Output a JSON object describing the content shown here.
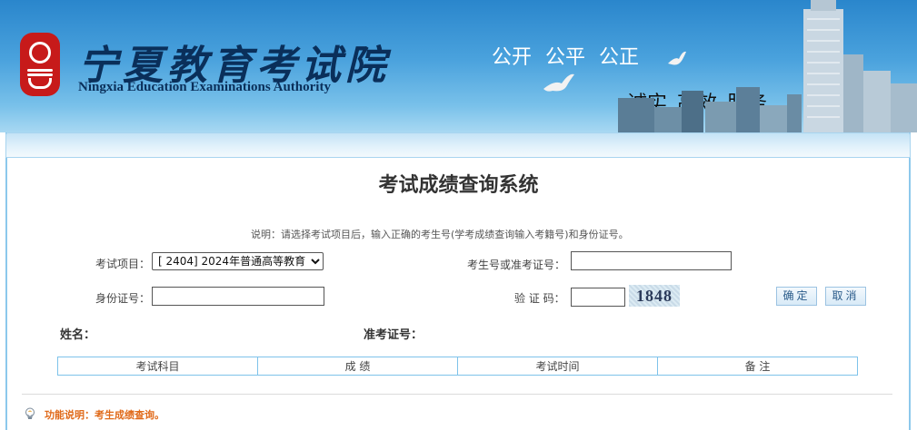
{
  "header": {
    "logo_cn": "宁夏教育考试院",
    "logo_en": "Ningxia Education Examinations Authority",
    "slogan_top": "公开  公平  公正",
    "slogan_bottom": "诚实  高效  服务"
  },
  "page": {
    "title": "考试成绩查询系统",
    "description": "说明：请选择考试项目后，输入正确的考生号(学考成绩查询输入考籍号)和身份证号。"
  },
  "form": {
    "exam_label": "考试项目：",
    "exam_selected": "[ 2404] 2024年普通高等教育",
    "candidate_no_label": "考生号或准考证号：",
    "candidate_no_value": "",
    "id_label": "身份证号：",
    "id_value": "",
    "captcha_label": "验 证 码：",
    "captcha_value": "",
    "captcha_image_text": "1848",
    "confirm_button": "确定",
    "cancel_button": "取消"
  },
  "info": {
    "name_label": "姓名：",
    "admission_label": "准考证号："
  },
  "results_table": {
    "columns": [
      "考试科目",
      "成 绩",
      "考试时间",
      "备 注"
    ]
  },
  "footer": {
    "tip_icon": "lightbulb-icon",
    "tip_text": "功能说明：考生成绩查询。"
  },
  "colors": {
    "banner_blue": "#2a86cc",
    "logo_red": "#c71a1a",
    "table_border": "#7ec3ea",
    "tip_orange": "#e06a1a"
  }
}
